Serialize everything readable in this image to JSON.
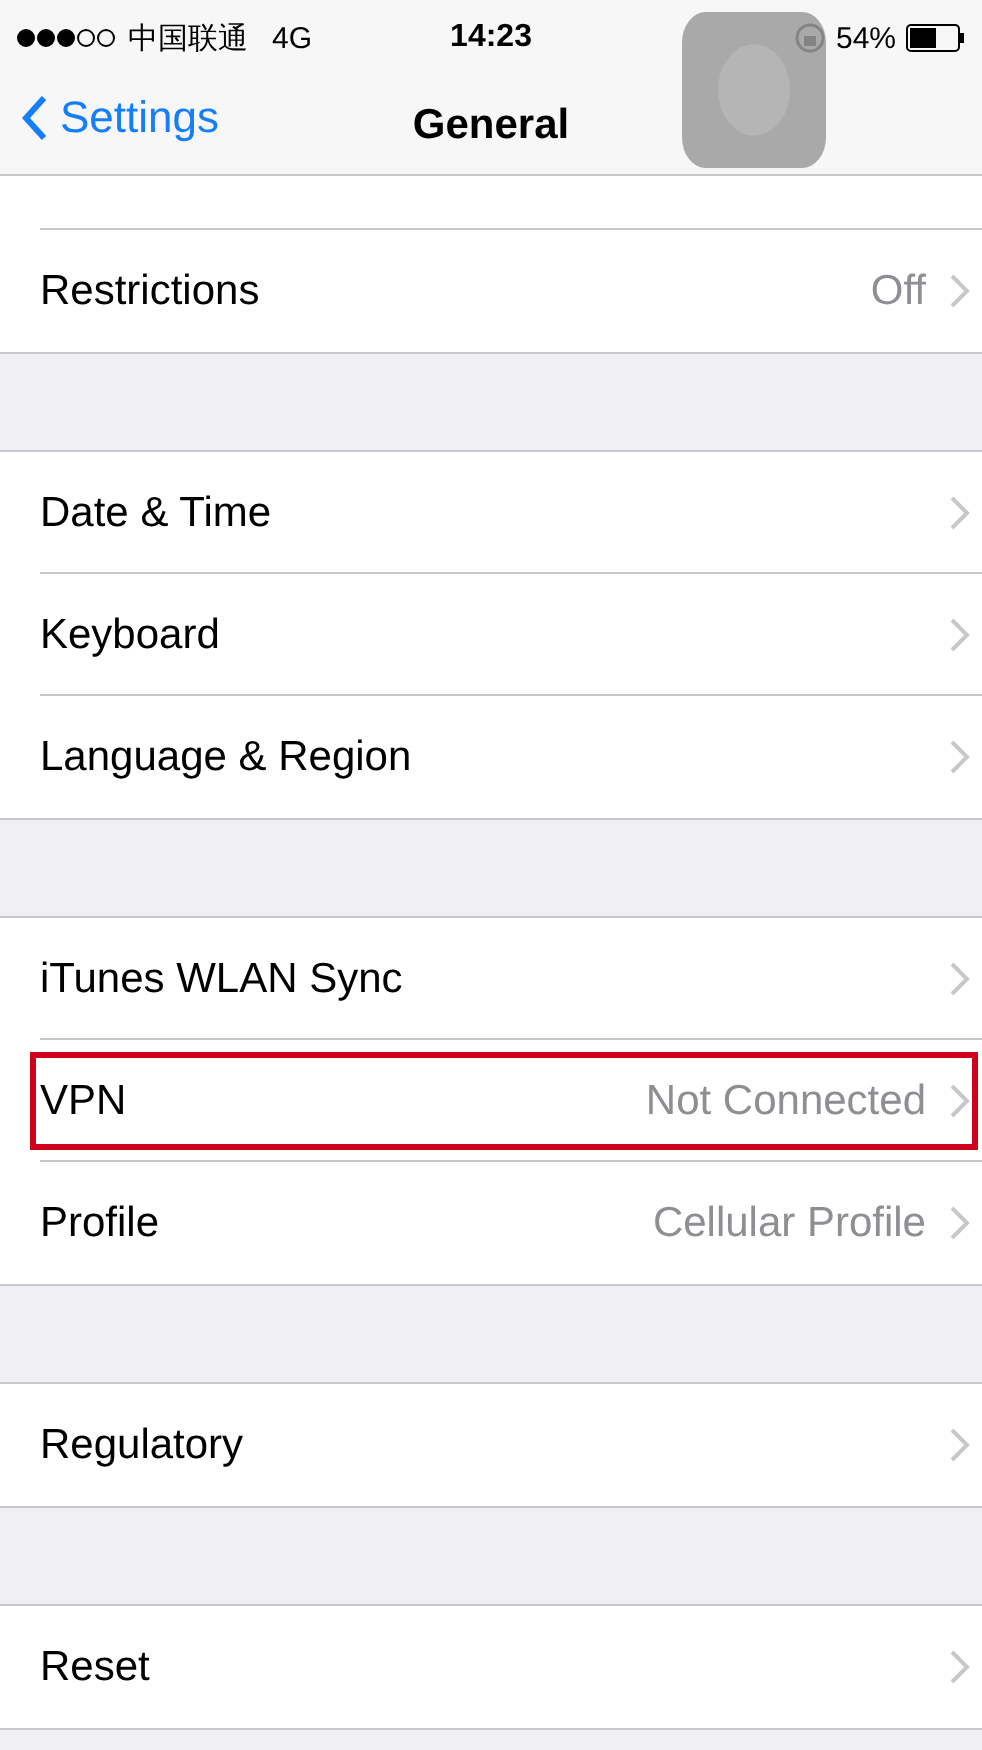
{
  "status_bar": {
    "carrier": "中国联通",
    "network": "4G",
    "time": "14:23",
    "battery": "54%"
  },
  "nav": {
    "back": "Settings",
    "title": "General"
  },
  "groups": [
    {
      "partial_top": true,
      "rows": [
        {
          "label": "Restrictions",
          "value": "Off",
          "highlighted": false
        }
      ]
    },
    {
      "rows": [
        {
          "label": "Date & Time",
          "highlighted": false
        },
        {
          "label": "Keyboard",
          "highlighted": false
        },
        {
          "label": "Language & Region",
          "highlighted": false
        }
      ]
    },
    {
      "rows": [
        {
          "label": "iTunes WLAN Sync",
          "highlighted": false
        },
        {
          "label": "VPN",
          "value": "Not Connected",
          "highlighted": true
        },
        {
          "label": "Profile",
          "value": "Cellular Profile",
          "highlighted": false
        }
      ]
    },
    {
      "rows": [
        {
          "label": "Regulatory",
          "highlighted": false
        }
      ]
    },
    {
      "rows": [
        {
          "label": "Reset",
          "highlighted": false
        }
      ]
    }
  ]
}
